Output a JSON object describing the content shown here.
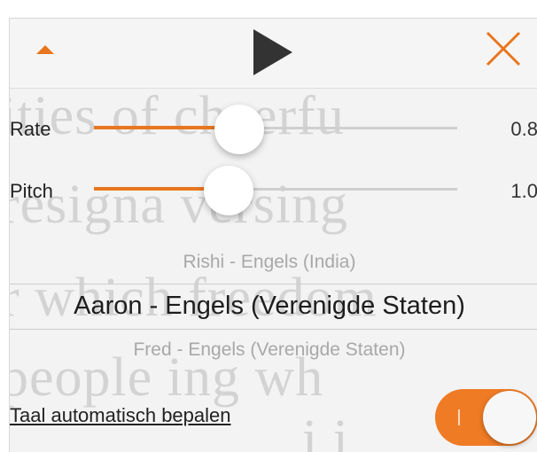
{
  "background_text": {
    "line1": "ities of cheerfu",
    "line2": "resigna versing",
    "line3": "r which freedom",
    "line4": "people ing wh",
    "line5": "i i"
  },
  "toolbar": {
    "collapse_icon": "triangle-up-icon",
    "play_icon": "play-icon",
    "close_icon": "close-icon",
    "accent_color": "#e8761f"
  },
  "rate": {
    "label": "Rate",
    "value": "0.8",
    "level": 0.4
  },
  "pitch": {
    "label": "Pitch",
    "value": "1.0",
    "level": 0.37
  },
  "voices": {
    "previous": "Rishi - Engels (India)",
    "selected": "Aaron - Engels (Verenigde Staten)",
    "next": "Fred - Engels (Verenigde Staten)"
  },
  "auto_language": {
    "label": "Taal automatisch bepalen",
    "enabled": true
  }
}
